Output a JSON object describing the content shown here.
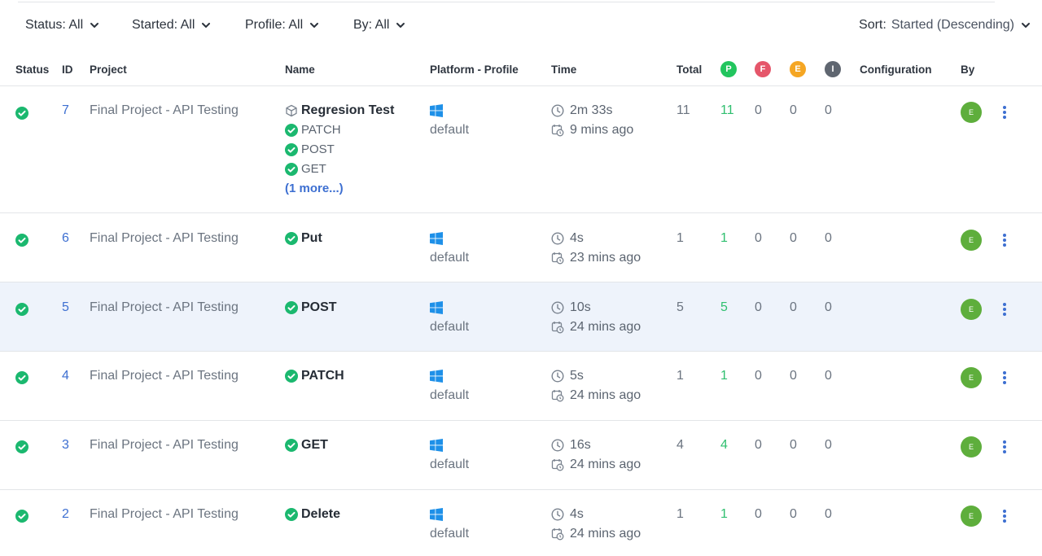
{
  "filters": {
    "status": "Status: All",
    "started": "Started: All",
    "profile": "Profile: All",
    "by": "By: All",
    "sort_label": "Sort:",
    "sort_value": "Started (Descending)"
  },
  "columns": {
    "status": "Status",
    "id": "ID",
    "project": "Project",
    "name": "Name",
    "platform": "Platform - Profile",
    "time": "Time",
    "total": "Total",
    "passed_badge": "P",
    "failed_badge": "F",
    "error_badge": "E",
    "incomplete_badge": "I",
    "configuration": "Configuration",
    "by": "By"
  },
  "colors": {
    "passed": "#22c55e",
    "failed": "#e5566a",
    "error": "#f5a623",
    "incomplete": "#5f6670",
    "link": "#3d6fd1",
    "avatar": "#5eae3c",
    "highlight_row": "#eef3fb"
  },
  "rows": [
    {
      "id": "7",
      "project": "Final Project - API Testing",
      "name": "Regresion Test",
      "name_icon": "cube-icon",
      "sub_items": [
        "PATCH",
        "POST",
        "GET"
      ],
      "more": "(1 more...)",
      "profile": "default",
      "duration": "2m 33s",
      "started": "9 mins ago",
      "total": "11",
      "passed": "11",
      "failed": "0",
      "error": "0",
      "incomplete": "0",
      "by": "E"
    },
    {
      "id": "6",
      "project": "Final Project - API Testing",
      "name": "Put",
      "profile": "default",
      "duration": "4s",
      "started": "23 mins ago",
      "total": "1",
      "passed": "1",
      "failed": "0",
      "error": "0",
      "incomplete": "0",
      "by": "E"
    },
    {
      "id": "5",
      "project": "Final Project - API Testing",
      "name": "POST",
      "profile": "default",
      "duration": "10s",
      "started": "24 mins ago",
      "total": "5",
      "passed": "5",
      "failed": "0",
      "error": "0",
      "incomplete": "0",
      "by": "E"
    },
    {
      "id": "4",
      "project": "Final Project - API Testing",
      "name": "PATCH",
      "profile": "default",
      "duration": "5s",
      "started": "24 mins ago",
      "total": "1",
      "passed": "1",
      "failed": "0",
      "error": "0",
      "incomplete": "0",
      "by": "E"
    },
    {
      "id": "3",
      "project": "Final Project - API Testing",
      "name": "GET",
      "profile": "default",
      "duration": "16s",
      "started": "24 mins ago",
      "total": "4",
      "passed": "4",
      "failed": "0",
      "error": "0",
      "incomplete": "0",
      "by": "E"
    },
    {
      "id": "2",
      "project": "Final Project - API Testing",
      "name": "Delete",
      "profile": "default",
      "duration": "4s",
      "started": "24 mins ago",
      "total": "1",
      "passed": "1",
      "failed": "0",
      "error": "0",
      "incomplete": "0",
      "by": "E"
    }
  ]
}
